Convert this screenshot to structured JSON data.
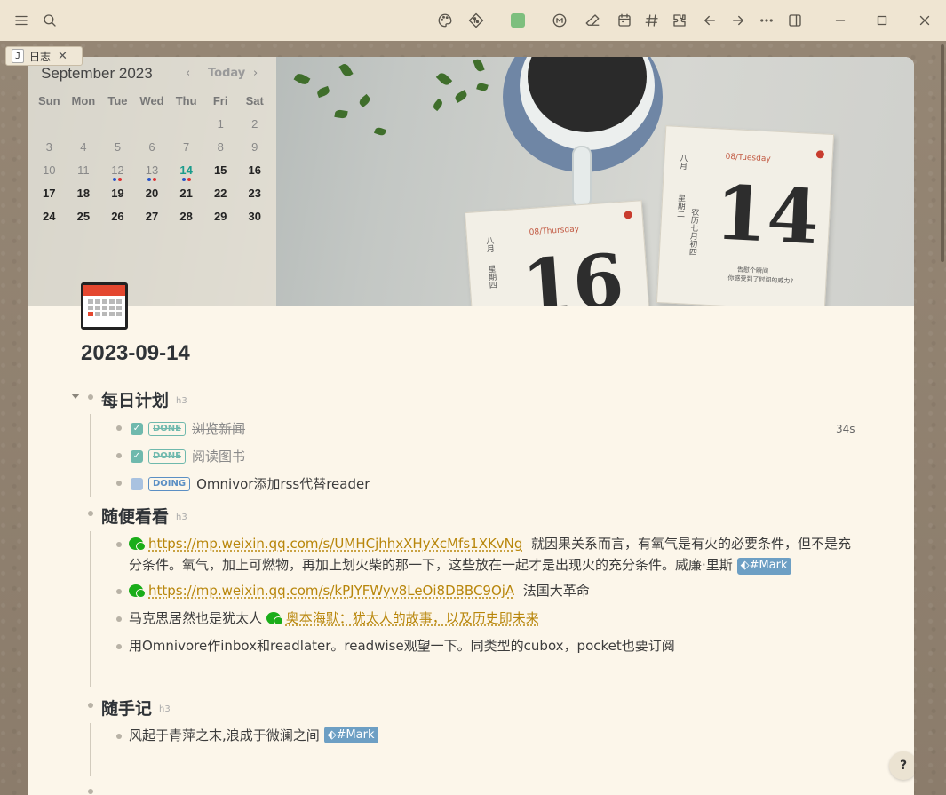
{
  "tab": {
    "badge": "J",
    "label": "日志",
    "close": "✕"
  },
  "calendar": {
    "month": "September 2023",
    "prev": "‹",
    "today_label": "Today",
    "next": "›",
    "weekdays": [
      "Sun",
      "Mon",
      "Tue",
      "Wed",
      "Thu",
      "Fri",
      "Sat"
    ],
    "weeks": [
      [
        "",
        "",
        "",
        "",
        "",
        "1",
        "2"
      ],
      [
        "3",
        "4",
        "5",
        "6",
        "7",
        "8",
        "9"
      ],
      [
        "10",
        "11",
        "12",
        "13",
        "14",
        "15",
        "16"
      ],
      [
        "17",
        "18",
        "19",
        "20",
        "21",
        "22",
        "23"
      ],
      [
        "24",
        "25",
        "26",
        "27",
        "28",
        "29",
        "30"
      ]
    ],
    "today": "14"
  },
  "banner": {
    "page_left": {
      "date": "16",
      "label": "08/Thursday",
      "lunar": "八月",
      "weekday": "星期四"
    },
    "page_right": {
      "date": "14",
      "label": "08/Tuesday",
      "lunar": "八月",
      "weekday": "星期二",
      "lunar_day": "农历七月初四",
      "caption1": "告慰个瞬间",
      "caption2": "你感受到了时间的威力?"
    }
  },
  "page": {
    "title": "2023-09-14"
  },
  "sections": {
    "daily": {
      "heading": "每日计划",
      "level": "h3",
      "items": [
        {
          "status": "DONE",
          "text": "浏览新闻"
        },
        {
          "status": "DONE",
          "text": "阅读图书"
        },
        {
          "status": "DOING",
          "text": "Omnivor添加rss代替reader"
        }
      ],
      "timer": "34s"
    },
    "reading": {
      "heading": "随便看看",
      "level": "h3",
      "item1": {
        "link": "https://mp.weixin.qq.com/s/UMHCjhhxXHyXcMfs1XKvNg",
        "text": "就因果关系而言，有氧气是有火的必要条件，但不是充分条件。氧气，加上可燃物，再加上划火柴的那一下，这些放在一起才是出现火的充分条件。威廉·里斯",
        "tag": "#Mark"
      },
      "item2": {
        "link": "https://mp.weixin.qq.com/s/kPJYFWyv8LeOi8DBBC9OjA",
        "text": "法国大革命"
      },
      "item3": {
        "prefix": "马克思居然也是犹太人",
        "link": "奥本海默：犹太人的故事，以及历史即未来"
      },
      "item4": {
        "text": "用Omnivore作inbox和readlater。readwise观望一下。同类型的cubox，pocket也要订阅"
      }
    },
    "notes": {
      "heading": "随手记",
      "level": "h3",
      "item1": {
        "text": "风起于青萍之末,浪成于微澜之间",
        "tag": "#Mark"
      }
    }
  },
  "help": {
    "label": "?"
  },
  "colors": {
    "accent": "#b8860b",
    "today": "#1a9c8c",
    "tag": "#6d9fc4"
  }
}
